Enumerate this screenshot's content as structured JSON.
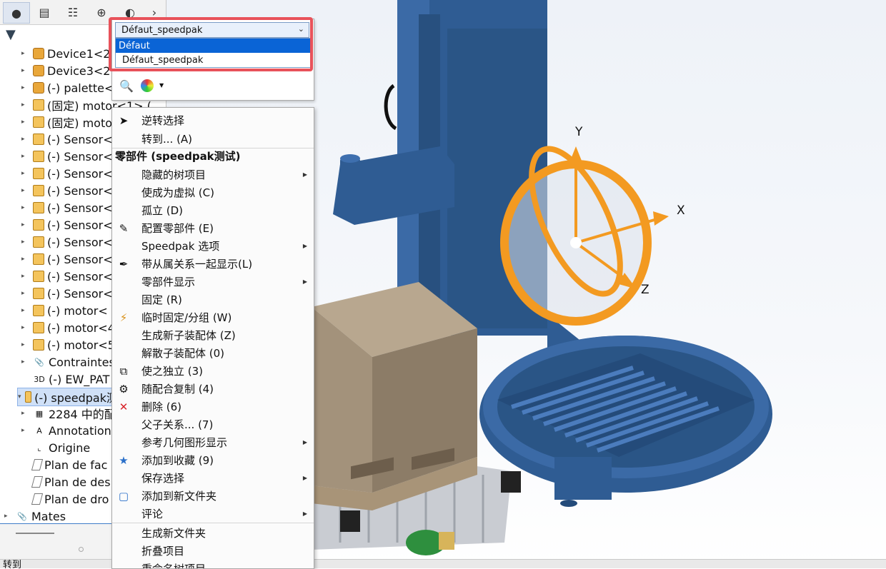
{
  "status_bar": {
    "text": "转到"
  },
  "tree_tabs": [
    "feature-manager-icon",
    "property-manager-icon",
    "configuration-manager-icon",
    "dimxpert-icon",
    "display-manager-icon",
    "expand-arrow-icon"
  ],
  "tree_items": [
    {
      "label": "Device1<2",
      "icon": "part"
    },
    {
      "label": "Device3<2",
      "icon": "part"
    },
    {
      "label": "(-) palette<",
      "icon": "part"
    },
    {
      "label": "(固定) motor<1> (",
      "icon": "asm"
    },
    {
      "label": "(固定) moto",
      "icon": "asm"
    },
    {
      "label": "(-) Sensor<",
      "icon": "asm"
    },
    {
      "label": "(-) Sensor<",
      "icon": "asm"
    },
    {
      "label": "(-) Sensor<",
      "icon": "asm"
    },
    {
      "label": "(-) Sensor<",
      "icon": "asm"
    },
    {
      "label": "(-) Sensor<",
      "icon": "asm"
    },
    {
      "label": "(-) Sensor<",
      "icon": "asm"
    },
    {
      "label": "(-) Sensor<",
      "icon": "asm"
    },
    {
      "label": "(-) Sensor<",
      "icon": "asm"
    },
    {
      "label": "(-) Sensor<",
      "icon": "asm"
    },
    {
      "label": "(-) Sensor<",
      "icon": "asm"
    },
    {
      "label": "(-) motor<",
      "icon": "asm"
    },
    {
      "label": "(-) motor<4",
      "icon": "asm"
    },
    {
      "label": "(-) motor<5",
      "icon": "asm"
    },
    {
      "label": "Contraintes",
      "icon": "mates"
    },
    {
      "label": "(-) EW_PAT",
      "icon": "3d"
    },
    {
      "label": "(-) speedpak测",
      "icon": "asm"
    },
    {
      "label": "2284 中的配",
      "icon": "config"
    },
    {
      "label": "Annotation",
      "icon": "annot"
    },
    {
      "label": "Origine",
      "icon": "origin"
    },
    {
      "label": "Plan de fac",
      "icon": "plane"
    },
    {
      "label": "Plan de des",
      "icon": "plane"
    },
    {
      "label": "Plan de dro",
      "icon": "plane"
    },
    {
      "label": "Mates",
      "icon": "mates"
    }
  ],
  "config_panel": {
    "selected": "Défaut_speedpak",
    "options": [
      "Défaut",
      "Défaut_speedpak"
    ],
    "highlighted_option": "Défaut"
  },
  "context_menu": {
    "items": [
      {
        "label": "逆转选择",
        "icon": "cursor",
        "sub": false
      },
      {
        "label": "转到... (A)",
        "icon": "",
        "sub": false
      },
      {
        "label": "零部件 (speedpak测试)",
        "header": true
      },
      {
        "label": "隐藏的树项目",
        "icon": "",
        "sub": true
      },
      {
        "label": "使成为虚拟 (C)",
        "icon": "",
        "sub": false
      },
      {
        "label": "孤立 (D)",
        "icon": "",
        "sub": false
      },
      {
        "label": "配置零部件 (E)",
        "icon": "edit",
        "sub": false
      },
      {
        "label": "Speedpak 选项",
        "icon": "",
        "sub": true
      },
      {
        "label": "带从属关系一起显示(L)",
        "icon": "pen",
        "sub": false
      },
      {
        "label": "零部件显示",
        "icon": "",
        "sub": true
      },
      {
        "label": "固定 (R)",
        "icon": "",
        "sub": false
      },
      {
        "label": "临时固定/分组 (W)",
        "icon": "group",
        "sub": false
      },
      {
        "label": "生成新子装配体 (Z)",
        "icon": "",
        "sub": false
      },
      {
        "label": "解散子装配体 (0)",
        "icon": "",
        "sub": false
      },
      {
        "label": "使之独立 (3)",
        "icon": "independent",
        "sub": false
      },
      {
        "label": "随配合复制 (4)",
        "icon": "copy",
        "sub": false
      },
      {
        "label": "删除 (6)",
        "icon": "delete",
        "sub": false
      },
      {
        "label": "父子关系... (7)",
        "icon": "",
        "sub": false
      },
      {
        "label": "参考几何图形显示",
        "icon": "",
        "sub": true
      },
      {
        "label": "添加到收藏 (9)",
        "icon": "favorite",
        "sub": false
      },
      {
        "label": "保存选择",
        "icon": "",
        "sub": true
      },
      {
        "label": "添加到新文件夹",
        "icon": "folder",
        "sub": false
      },
      {
        "label": "评论",
        "icon": "",
        "sub": true
      },
      {
        "label": "生成新文件夹",
        "icon": "",
        "sub": false
      },
      {
        "label": "折叠项目",
        "icon": "",
        "sub": false
      },
      {
        "label": "重命名树项目",
        "icon": "",
        "sub": false
      }
    ]
  },
  "triad": {
    "x": "X",
    "y": "Y",
    "z": "Z"
  },
  "colors": {
    "machine_blue": "#2f5c93",
    "triad_orange": "#f39a21",
    "selection_blue": "#0a64d6",
    "highlight_red": "#e8525a"
  }
}
